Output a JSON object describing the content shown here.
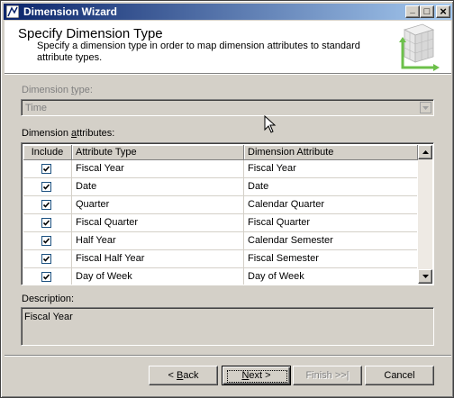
{
  "window": {
    "title": "Dimension Wizard",
    "minimize_glyph": "_",
    "maximize_glyph": "□",
    "close_glyph": "×"
  },
  "header": {
    "title": "Specify Dimension Type",
    "description": "Specify a dimension type in order to map dimension attributes to standard attribute types."
  },
  "dimension_type": {
    "label_before": "Dimension ",
    "label_accel": "t",
    "label_after": "ype:",
    "value": "Time",
    "enabled": false
  },
  "attributes": {
    "label_before": "Dimension ",
    "label_accel": "a",
    "label_after": "ttributes:",
    "columns": [
      "Include",
      "Attribute Type",
      "Dimension Attribute"
    ],
    "rows": [
      {
        "include": true,
        "attribute_type": "Fiscal Year",
        "dimension_attribute": "Fiscal Year"
      },
      {
        "include": true,
        "attribute_type": "Date",
        "dimension_attribute": "Date"
      },
      {
        "include": true,
        "attribute_type": "Quarter",
        "dimension_attribute": "Calendar Quarter"
      },
      {
        "include": true,
        "attribute_type": "Fiscal Quarter",
        "dimension_attribute": "Fiscal Quarter"
      },
      {
        "include": true,
        "attribute_type": "Half Year",
        "dimension_attribute": "Calendar Semester"
      },
      {
        "include": true,
        "attribute_type": "Fiscal Half Year",
        "dimension_attribute": "Fiscal Semester"
      },
      {
        "include": true,
        "attribute_type": "Day of Week",
        "dimension_attribute": "Day of Week"
      }
    ]
  },
  "description": {
    "label": "Description:",
    "value": "Fiscal Year"
  },
  "buttons": {
    "back_prefix": "< ",
    "back_accel": "B",
    "back_suffix": "ack",
    "next_accel": "N",
    "next_suffix": "ext >",
    "finish_label": "Finish >>|",
    "cancel_label": "Cancel"
  },
  "colors": {
    "titlebar_start": "#0a246a",
    "titlebar_end": "#a6caf0",
    "face": "#d4d0c8",
    "graphic_green": "#6cc04a"
  },
  "icons": {
    "app": "dimension-wizard-icon",
    "header": "dimension-cube-graphic",
    "check": "checkmark-icon"
  }
}
